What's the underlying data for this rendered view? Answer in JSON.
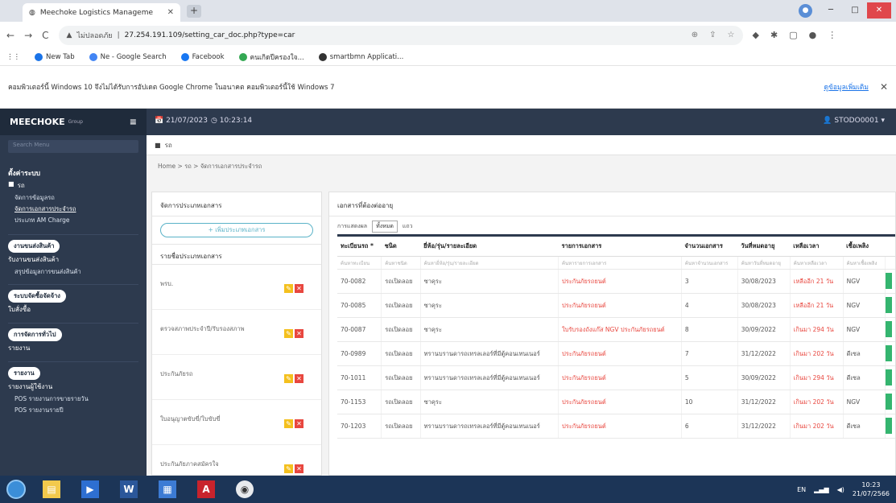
{
  "browser": {
    "tab_title": "Meechoke Logistics Manageme",
    "url_prefix": "ไม่ปลอดภัย",
    "url": "27.254.191.109/setting_car_doc.php?type=car",
    "bookmarks": [
      {
        "label": "New Tab",
        "color": "#1a73e8"
      },
      {
        "label": "Ne - Google Search",
        "color": "#4285f4"
      },
      {
        "label": "Facebook",
        "color": "#1877f2"
      },
      {
        "label": "คนเกิดปีครองใจ...",
        "color": "#34a853"
      },
      {
        "label": "smartbmn Applicati...",
        "color": "#333333"
      }
    ]
  },
  "infobar": {
    "message": "คอมพิวเตอร์นี้ Windows 10 จึงไม่ได้รับการอัปเดต Google Chrome ในอนาคต คอมพิวเตอร์นี้ใช้ Windows 7",
    "action": "ดูข้อมูลเพิ่มเติม",
    "close": "✕"
  },
  "topnav": {
    "brand": "MEECHOKE",
    "brand_small": "Group",
    "date": "21/07/2023",
    "time": "10:23:14",
    "user": "STODO0001"
  },
  "sidebar": {
    "search_placeholder": "Search Menu",
    "section1_title": "ตั้งค่าระบบ",
    "section1_item": "รถ",
    "section1_subs": [
      "จัดการข้อมูลรถ",
      "จัดการเอกสารประจำรถ",
      "ประเภท AM Charge"
    ],
    "cards": [
      {
        "badge": "งานขนส่งสินค้า",
        "items": [
          "รับงานขนส่งสินค้า",
          "สรุปข้อมูลการขนส่งสินค้า"
        ]
      },
      {
        "badge": "ระบบจัดซื้อจัดจ้าง",
        "items": [
          "ใบสั่งซื้อ"
        ]
      },
      {
        "badge": "การจัดการทั่วไป",
        "items": [
          "รายงาน"
        ]
      },
      {
        "badge": "รายงาน",
        "items": [
          "รายงานผู้ใช้งาน",
          "POS รายงานการขายรายวัน",
          "POS รายงานรายปี"
        ]
      }
    ]
  },
  "main": {
    "crumb_top": "รถ",
    "breadcrumb": "Home > รถ > จัดการเอกสารประจำรถ",
    "left_panel": {
      "title": "จัดการประเภทเอกสาร",
      "add_button": "+ เพิ่มประเภทเอกสาร",
      "list_title": "รายชื่อประเภทเอกสาร",
      "items": [
        "พรบ.",
        "ตรวจสภาพประจำปี/รับรองสภาพ",
        "ประกันภัยรถ",
        "ใบอนุญาตขับขี่/ใบขับขี่",
        "ประกันภัยภาคสมัครใจ"
      ]
    },
    "right_panel": {
      "title": "เอกสารที่ต้องต่ออายุ",
      "filter_label": "การแสดงผล",
      "filter_button": "ทั้งหมด",
      "filter_suffix": "แถว",
      "columns": [
        "ทะเบียนรถ *",
        "ชนิด",
        "ยี่ห้อ/รุ่น/รายละเอียด",
        "รายการเอกสาร",
        "จำนวนเอกสาร",
        "วันที่หมดอายุ",
        "เหลือเวลา",
        "เชื้อเพลิง"
      ],
      "filter_hints": [
        "ค้นหาทะเบียน",
        "ค้นหาชนิด",
        "ค้นหายี่ห้อ/รุ่น/รายละเอียด",
        "ค้นหารายการเอกสาร",
        "ค้นหาจำนวนเอกสาร",
        "ค้นหาวันที่หมดอายุ",
        "ค้นหาเหลือเวลา",
        "ค้นหาเชื้อเพลิง"
      ],
      "rows": [
        [
          "70-0082",
          "รถเปิดลอย",
          "ซาคุระ",
          "ประกันภัยรถยนต์",
          "3",
          "30/08/2023",
          "เหลืออีก 21 วัน",
          "NGV"
        ],
        [
          "70-0085",
          "รถเปิดลอย",
          "ซาคุระ",
          "ประกันภัยรถยนต์",
          "4",
          "30/08/2023",
          "เหลืออีก 21 วัน",
          "NGV"
        ],
        [
          "70-0087",
          "รถเปิดลอย",
          "ซาคุระ",
          "ใบรับรองถังแก๊ส NGV ประกันภัยรถยนต์",
          "8",
          "30/09/2022",
          "เกินมา 294 วัน",
          "NGV"
        ],
        [
          "70-0989",
          "รถเปิดลอย",
          "ทรานบรานดารถเทรลเลอร์ที่มีตู้คอนเทนเนอร์",
          "ประกันภัยรถยนต์",
          "7",
          "31/12/2022",
          "เกินมา 202 วัน",
          "ดีเซล"
        ],
        [
          "70-1011",
          "รถเปิดลอย",
          "ทรานบรานดารถเทรลเลอร์ที่มีตู้คอนเทนเนอร์",
          "ประกันภัยรถยนต์",
          "5",
          "30/09/2022",
          "เกินมา 294 วัน",
          "ดีเซล"
        ],
        [
          "70-1153",
          "รถเปิดลอย",
          "ซาคุระ",
          "ประกันภัยรถยนต์",
          "10",
          "31/12/2022",
          "เกินมา 202 วัน",
          "NGV"
        ],
        [
          "70-1203",
          "รถเปิดลอย",
          "ทรานบรานดารถเทรลเลอร์ที่มีตู้คอนเทนเนอร์",
          "ประกันภัยรถยนต์",
          "6",
          "31/12/2022",
          "เกินมา 202 วัน",
          "ดีเซล"
        ]
      ]
    }
  },
  "taskbar": {
    "lang": "EN",
    "time": "10:23",
    "date": "21/07/2566"
  }
}
